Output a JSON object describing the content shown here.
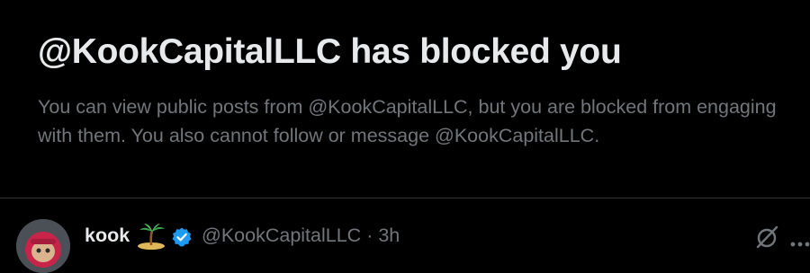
{
  "block_notice": {
    "title": "@KookCapitalLLC has blocked you",
    "description": "You can view public posts from @KookCapitalLLC, but you are blocked from engaging with them. You also cannot follow or message @KookCapitalLLC."
  },
  "post": {
    "display_name": "kook",
    "handle": "@KookCapitalLLC",
    "separator": "·",
    "timestamp": "3h",
    "name_emoji_icon": "desert-island-icon",
    "badge_icon": "verified-badge-icon",
    "actions": [
      "grok-icon",
      "more-icon"
    ]
  },
  "colors": {
    "background": "#000000",
    "primary_text": "#e7e9ea",
    "secondary_text": "#71767b",
    "divider": "#2f3336",
    "verified_blue": "#1d9bf0"
  }
}
